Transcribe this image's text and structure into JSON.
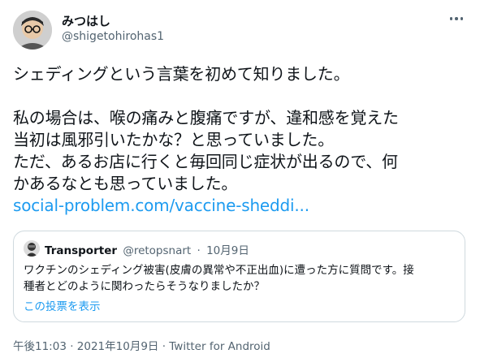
{
  "author": {
    "name": "みつはし",
    "handle": "@shigetohirohas1"
  },
  "tweet": {
    "paragraph1": "シェディングという言葉を初めて知りました。",
    "paragraph2_lines": [
      "私の場合は、喉の痛みと腹痛ですが、違和感を覚えた",
      "当初は風邪引いたかな？と思っていました。",
      "ただ、あるお店に行くと毎回同じ症状が出るので、何",
      "かあるなとも思っていました。"
    ],
    "link_text": "social-problem.com/vaccine-sheddi..."
  },
  "quote": {
    "name": "Transporter",
    "handle": "@retopsnart",
    "separator": "·",
    "date": "10月9日",
    "body_lines": [
      "ワクチンのシェディング被害(皮膚の異常や不正出血)に遭った方に質問です。接",
      "種者とどのように関わったらそうなりましたか？"
    ],
    "poll_link": "この投票を表示"
  },
  "footer": {
    "meta": "午後11:03 · 2021年10月9日 · Twitter for Android"
  },
  "icons": {
    "more": "more-horizontal-icon",
    "avatar": "avatar-photo",
    "quote_avatar": "quote-avatar-photo"
  }
}
